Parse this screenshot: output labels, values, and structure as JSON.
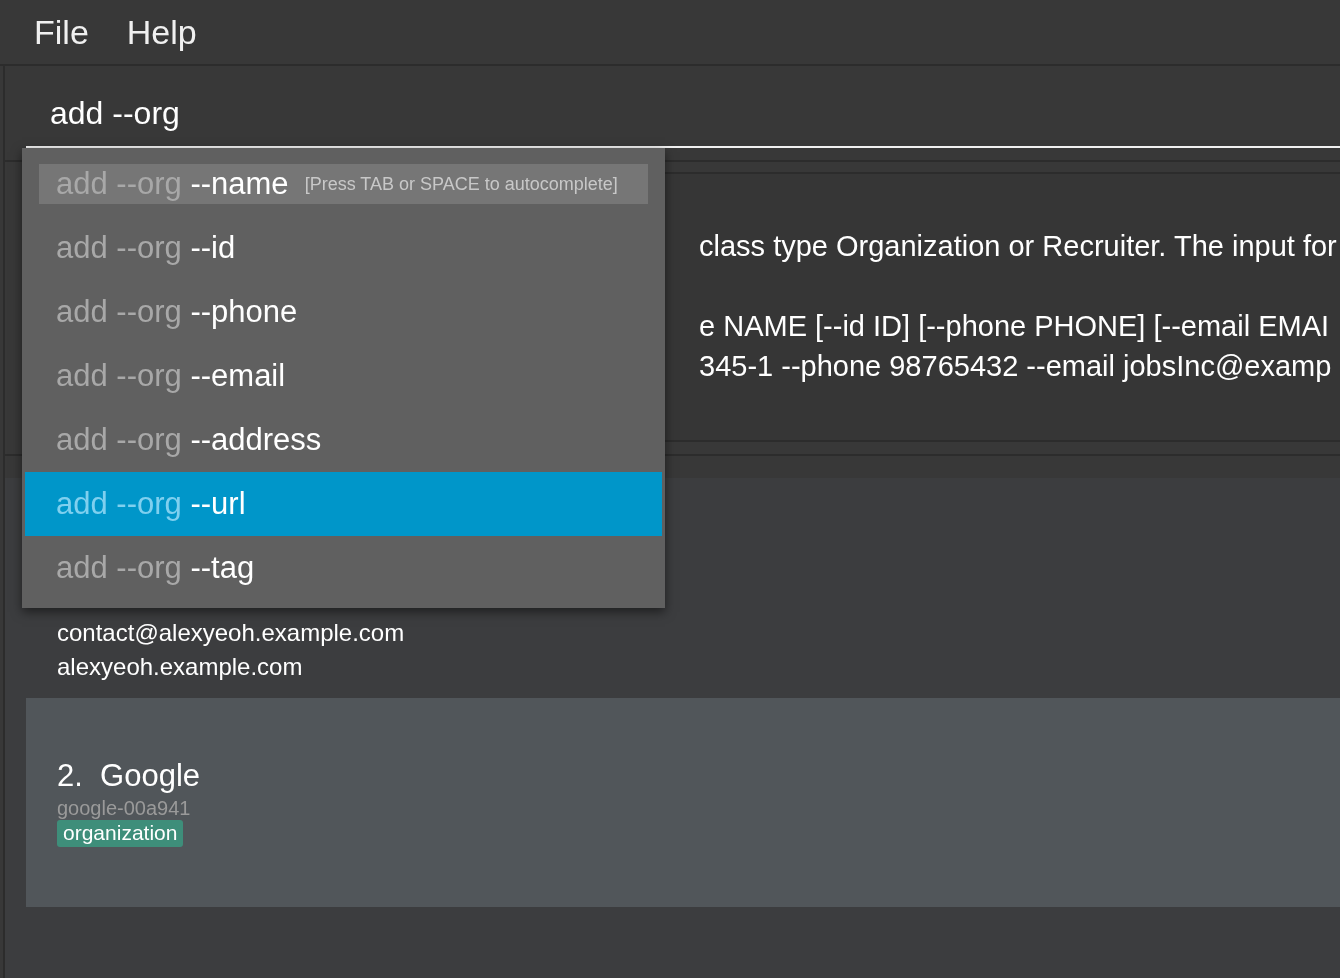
{
  "menu": [
    {
      "label": "File"
    },
    {
      "label": "Help"
    }
  ],
  "command_box": {
    "value": "add --org"
  },
  "autocomplete": [
    {
      "prefix": "add --org",
      "option": "--name",
      "hint": "[Press TAB or SPACE to autocomplete]",
      "highlighted": true,
      "selected": false
    },
    {
      "prefix": "add --org",
      "option": "--id",
      "highlighted": false,
      "selected": false
    },
    {
      "prefix": "add --org",
      "option": "--phone",
      "highlighted": false,
      "selected": false
    },
    {
      "prefix": "add --org",
      "option": "--email",
      "highlighted": false,
      "selected": false
    },
    {
      "prefix": "add --org",
      "option": "--address",
      "highlighted": false,
      "selected": false
    },
    {
      "prefix": "add --org",
      "option": "--url",
      "highlighted": false,
      "selected": true
    },
    {
      "prefix": "add --org",
      "option": "--tag",
      "highlighted": false,
      "selected": false
    }
  ],
  "result_display": {
    "paragraphs": [
      [
        "class type Organization or Recruiter. The input for"
      ],
      [
        "e NAME [--id ID] [--phone PHONE] [--email EMAI",
        "345-1 --phone 98765432 --email jobsInc@examp"
      ]
    ]
  },
  "contacts": [
    {
      "selected": false,
      "lines": [
        "contact@alexyeoh.example.com",
        "alexyeoh.example.com"
      ]
    },
    {
      "selected": true,
      "index": "2.",
      "name": "Google",
      "id": "google-00a941",
      "tags": [
        "organization"
      ]
    }
  ]
}
